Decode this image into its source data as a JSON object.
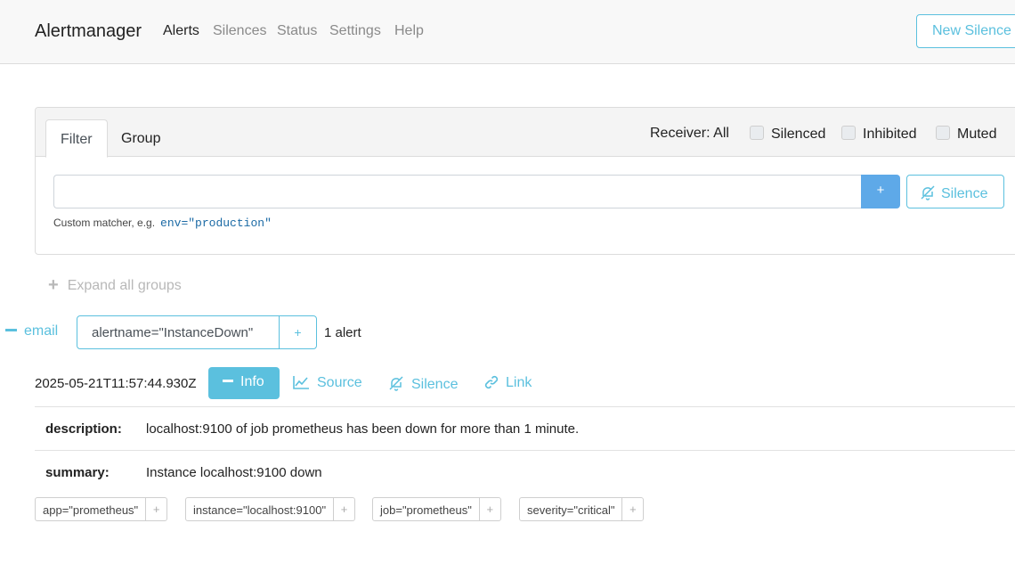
{
  "nav": {
    "brand": "Alertmanager",
    "links": [
      "Alerts",
      "Silences",
      "Status",
      "Settings",
      "Help"
    ],
    "new_silence": "New Silence"
  },
  "filter": {
    "tabs": [
      "Filter",
      "Group"
    ],
    "receiver": "Receiver: All",
    "checkboxes": [
      "Silenced",
      "Inhibited",
      "Muted"
    ],
    "input_value": "",
    "add_label": "+",
    "silence_label": "Silence",
    "hint_text": "Custom matcher, e.g.",
    "hint_example": "env=\"production\""
  },
  "expand_all": "Expand all groups",
  "group": {
    "receiver": "email",
    "matcher": "alertname=\"InstanceDown\"",
    "add_label": "+",
    "count": "1 alert"
  },
  "alert": {
    "timestamp": "2025-05-21T11:57:44.930Z",
    "info_label": "Info",
    "source_label": "Source",
    "silence_label": "Silence",
    "link_label": "Link",
    "annotations": [
      {
        "key": "description:",
        "value": "localhost:9100 of job prometheus has been down for more than 1 minute."
      },
      {
        "key": "summary:",
        "value": "Instance localhost:9100 down"
      }
    ],
    "labels": [
      "app=\"prometheus\"",
      "instance=\"localhost:9100\"",
      "job=\"prometheus\"",
      "severity=\"critical\""
    ],
    "label_add": "+"
  },
  "colors": {
    "accent": "#5bc0de",
    "primary": "#5ea9e8",
    "muted": "#8a8a8a"
  }
}
